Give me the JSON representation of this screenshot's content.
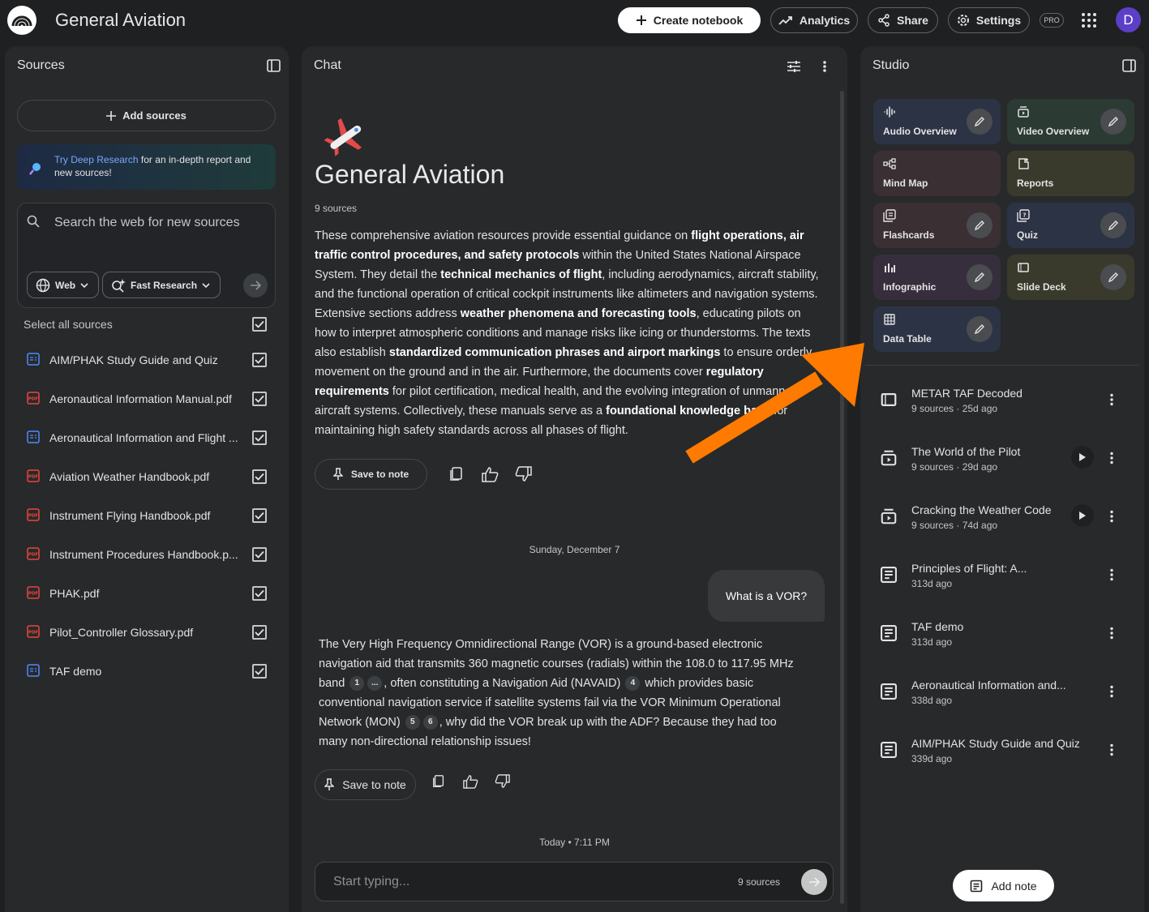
{
  "app": {
    "title": "General Aviation",
    "avatar_letter": "D",
    "badge": "PRO"
  },
  "header": {
    "create_label": "Create notebook",
    "analytics_label": "Analytics",
    "share_label": "Share",
    "settings_label": "Settings"
  },
  "sources": {
    "title": "Sources",
    "add_label": "Add sources",
    "deep_link": "Try Deep Research",
    "deep_text": " for an in-depth report and new sources!",
    "search_placeholder": "Search the web for new sources",
    "web_chip": "Web",
    "fast_chip": "Fast Research",
    "select_all": "Select all sources",
    "items": [
      {
        "name": "AIM/PHAK Study Guide and Quiz",
        "icon": "doc-icon",
        "checked": true
      },
      {
        "name": "Aeronautical Information Manual.pdf",
        "icon": "pdf-icon",
        "checked": true
      },
      {
        "name": "Aeronautical Information and Flight ...",
        "icon": "doc-icon",
        "checked": true
      },
      {
        "name": "Aviation Weather Handbook.pdf",
        "icon": "pdf-icon",
        "checked": true
      },
      {
        "name": "Instrument Flying Handbook.pdf",
        "icon": "pdf-icon",
        "checked": true
      },
      {
        "name": "Instrument Procedures Handbook.p...",
        "icon": "pdf-icon",
        "checked": true
      },
      {
        "name": "PHAK.pdf",
        "icon": "pdf-icon",
        "checked": true
      },
      {
        "name": "Pilot_Controller Glossary.pdf",
        "icon": "pdf-icon",
        "checked": true
      },
      {
        "name": "TAF demo",
        "icon": "doc-icon",
        "checked": true
      }
    ]
  },
  "chat": {
    "title": "Chat",
    "notebook_title": "General Aviation",
    "source_count": "9 sources",
    "summary": [
      {
        "t": "These comprehensive aviation resources provide essential guidance on "
      },
      {
        "t": "flight operations, air traffic control procedures, and safety protocols",
        "b": true
      },
      {
        "t": " within the United States National Airspace System. They detail the "
      },
      {
        "t": "technical mechanics of flight",
        "b": true
      },
      {
        "t": ", including aerodynamics, aircraft stability, and the functional operation of critical cockpit instruments like altimeters and navigation systems. Extensive sections address "
      },
      {
        "t": "weather phenomena and forecasting tools",
        "b": true
      },
      {
        "t": ", educating pilots on how to interpret atmospheric conditions and manage risks like icing or thunderstorms. The texts also establish "
      },
      {
        "t": "standardized communication phrases and airport markings",
        "b": true
      },
      {
        "t": " to ensure orderly movement on the ground and in the air. Furthermore, the documents cover "
      },
      {
        "t": "regulatory requirements",
        "b": true
      },
      {
        "t": " for pilot certification, medical health, and the evolving integration of unmanned aircraft systems. Collectively, these manuals serve as a "
      },
      {
        "t": "foundational knowledge base",
        "b": true
      },
      {
        "t": " for maintaining high safety standards across all phases of flight."
      }
    ],
    "save_note": "Save to note",
    "date1": "Sunday, December 7",
    "user_msg": "What is a VOR?",
    "answer": [
      {
        "t": "The Very High Frequency Omnidirectional Range (VOR) is a ground-based electronic navigation aid that transmits 360 magnetic courses (radials) within the 108.0 to 117.95 MHz band "
      },
      {
        "c": "1"
      },
      {
        "c": "..."
      },
      {
        "t": ", often constituting a Navigation Aid (NAVAID) "
      },
      {
        "c": "4"
      },
      {
        "t": " which provides basic conventional navigation service if satellite systems fail via the VOR Minimum Operational Network (MON) "
      },
      {
        "c": "5"
      },
      {
        "c": "6"
      },
      {
        "t": ", why did the VOR break up with the ADF? Because they had too many non-directional relationship issues!"
      }
    ],
    "date2": "Today • 7:11 PM",
    "input_placeholder": "Start typing...",
    "input_count": "9 sources"
  },
  "studio": {
    "title": "Studio",
    "tiles": [
      {
        "label": "Audio Overview",
        "icon": "waveform-icon",
        "bg": "#2c3344",
        "edit": true
      },
      {
        "label": "Video Overview",
        "icon": "video-icon",
        "bg": "#2b3a33",
        "edit": true
      },
      {
        "label": "Mind Map",
        "icon": "mindmap-icon",
        "bg": "#3a2f33",
        "edit": false
      },
      {
        "label": "Reports",
        "icon": "report-icon",
        "bg": "#3a3a2c",
        "edit": false
      },
      {
        "label": "Flashcards",
        "icon": "flashcards-icon",
        "bg": "#3a2f33",
        "edit": true
      },
      {
        "label": "Quiz",
        "icon": "quiz-icon",
        "bg": "#2c3344",
        "edit": true
      },
      {
        "label": "Infographic",
        "icon": "infographic-icon",
        "bg": "#372e3d",
        "edit": true
      },
      {
        "label": "Slide Deck",
        "icon": "slides-icon",
        "bg": "#3a3a2c",
        "edit": true
      },
      {
        "label": "Data Table",
        "icon": "table-icon",
        "bg": "#2c3344",
        "edit": true
      }
    ],
    "notes": [
      {
        "title": "METAR TAF Decoded",
        "sub": "9 sources · 25d ago",
        "icon": "slides-icon",
        "play": false
      },
      {
        "title": "The World of the Pilot",
        "sub": "9 sources · 29d ago",
        "icon": "video-icon",
        "play": true
      },
      {
        "title": "Cracking the Weather Code",
        "sub": "9 sources · 74d ago",
        "icon": "video-icon",
        "play": true
      },
      {
        "title": "Principles of Flight: A...",
        "sub": "313d ago",
        "icon": "note-icon",
        "play": false
      },
      {
        "title": "TAF demo",
        "sub": "313d ago",
        "icon": "note-icon",
        "play": false
      },
      {
        "title": "Aeronautical Information and...",
        "sub": "338d ago",
        "icon": "note-icon",
        "play": false
      },
      {
        "title": "AIM/PHAK Study Guide and Quiz",
        "sub": "339d ago",
        "icon": "note-icon",
        "play": false
      }
    ],
    "add_note": "Add note"
  },
  "colors": {
    "bg": "#1f2022",
    "panel": "#28292b",
    "accent_link": "#7aa6ff",
    "pdf": "#e8453c",
    "doc": "#4a8cff",
    "arrow": "#ff7a00",
    "avatar": "#5b3fc7"
  }
}
